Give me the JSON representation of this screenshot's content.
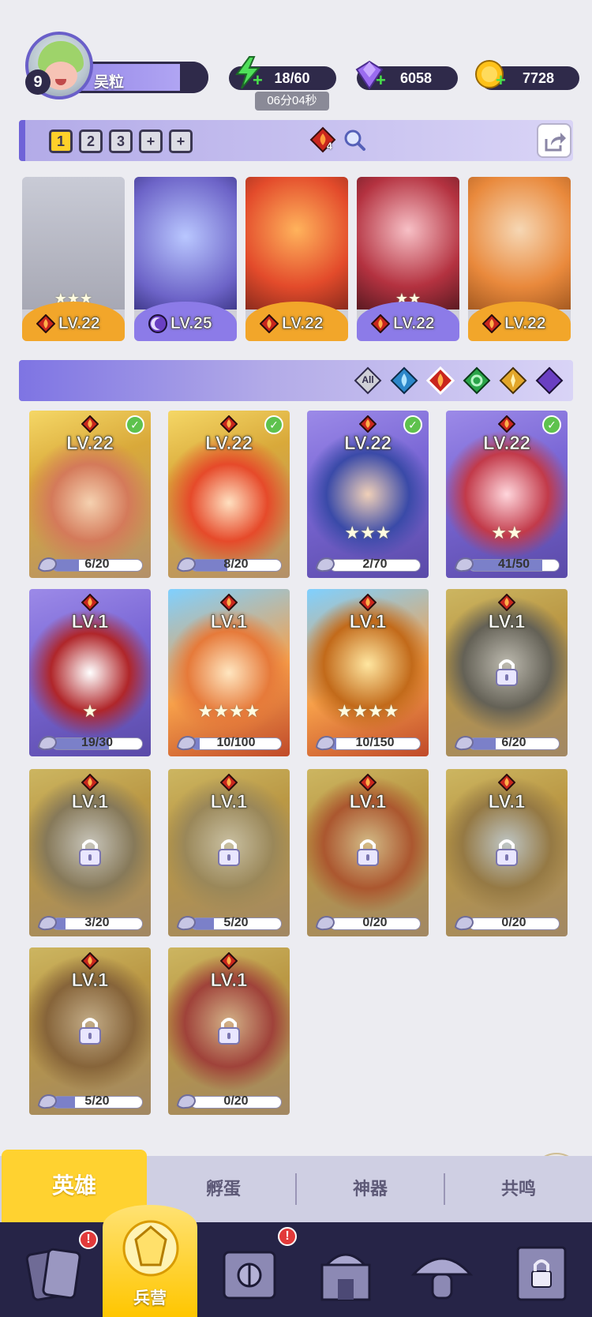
{
  "player": {
    "name": "吴粒",
    "level": "9"
  },
  "resources": {
    "energy": "18/60",
    "energy_timer": "06分04秒",
    "gems": "6058",
    "coins": "7728"
  },
  "team_bar": {
    "slots": [
      "1",
      "2",
      "3",
      "+",
      "+"
    ],
    "active_slot": "1",
    "item_count": "4"
  },
  "team_heroes": [
    {
      "level": "LV.22",
      "element": "fire",
      "stars": "★★★"
    },
    {
      "level": "LV.25",
      "element": "dark",
      "stars": ""
    },
    {
      "level": "LV.22",
      "element": "fire",
      "stars": ""
    },
    {
      "level": "LV.22",
      "element": "fire",
      "stars": "★★"
    },
    {
      "level": "LV.22",
      "element": "fire",
      "stars": ""
    }
  ],
  "filters": [
    {
      "label": "All",
      "icon": "all-icon"
    },
    {
      "label": "",
      "icon": "water-element-icon"
    },
    {
      "label": "",
      "icon": "fire-element-icon"
    },
    {
      "label": "",
      "icon": "wind-element-icon"
    },
    {
      "label": "",
      "icon": "light-element-icon"
    },
    {
      "label": "",
      "icon": "dark-element-icon"
    }
  ],
  "heroes": [
    {
      "level": "LV.22",
      "progress": "6/20",
      "fill": 0.3,
      "stars": "",
      "in_team": true,
      "locked": false,
      "frame": "gold"
    },
    {
      "level": "LV.22",
      "progress": "8/20",
      "fill": 0.4,
      "stars": "",
      "in_team": true,
      "locked": false,
      "frame": "gold"
    },
    {
      "level": "LV.22",
      "progress": "2/70",
      "fill": 0.03,
      "stars": "★★★",
      "in_team": true,
      "locked": false,
      "frame": "purple"
    },
    {
      "level": "LV.22",
      "progress": "41/50",
      "fill": 0.82,
      "stars": "★★",
      "in_team": true,
      "locked": false,
      "frame": "purple"
    },
    {
      "level": "LV.1",
      "progress": "19/30",
      "fill": 0.63,
      "stars": "★",
      "in_team": false,
      "locked": false,
      "frame": "purple"
    },
    {
      "level": "LV.1",
      "progress": "10/100",
      "fill": 0.1,
      "stars": "★★★★",
      "in_team": false,
      "locked": false,
      "frame": "blue"
    },
    {
      "level": "LV.1",
      "progress": "10/150",
      "fill": 0.07,
      "stars": "★★★★",
      "in_team": false,
      "locked": false,
      "frame": "blue"
    },
    {
      "level": "LV.1",
      "progress": "6/20",
      "fill": 0.3,
      "stars": "",
      "in_team": false,
      "locked": true,
      "frame": "gold"
    },
    {
      "level": "LV.1",
      "progress": "3/20",
      "fill": 0.15,
      "stars": "",
      "in_team": false,
      "locked": true,
      "frame": "gold"
    },
    {
      "level": "LV.1",
      "progress": "5/20",
      "fill": 0.25,
      "stars": "",
      "in_team": false,
      "locked": true,
      "frame": "gold"
    },
    {
      "level": "LV.1",
      "progress": "0/20",
      "fill": 0.0,
      "stars": "",
      "in_team": false,
      "locked": true,
      "frame": "gold"
    },
    {
      "level": "LV.1",
      "progress": "0/20",
      "fill": 0.0,
      "stars": "",
      "in_team": false,
      "locked": true,
      "frame": "gold"
    },
    {
      "level": "LV.1",
      "progress": "5/20",
      "fill": 0.25,
      "stars": "",
      "in_team": false,
      "locked": true,
      "frame": "gold"
    },
    {
      "level": "LV.1",
      "progress": "0/20",
      "fill": 0.0,
      "stars": "",
      "in_team": false,
      "locked": true,
      "frame": "gold"
    }
  ],
  "sub_tabs": [
    "英雄",
    "孵蛋",
    "神器",
    "共鸣"
  ],
  "nav": {
    "active_label": "兵营",
    "badge": "!"
  },
  "colors": {
    "accent": "#6f63d8",
    "gold": "#ffd230",
    "dark": "#262447",
    "fire": "#c9261d"
  }
}
